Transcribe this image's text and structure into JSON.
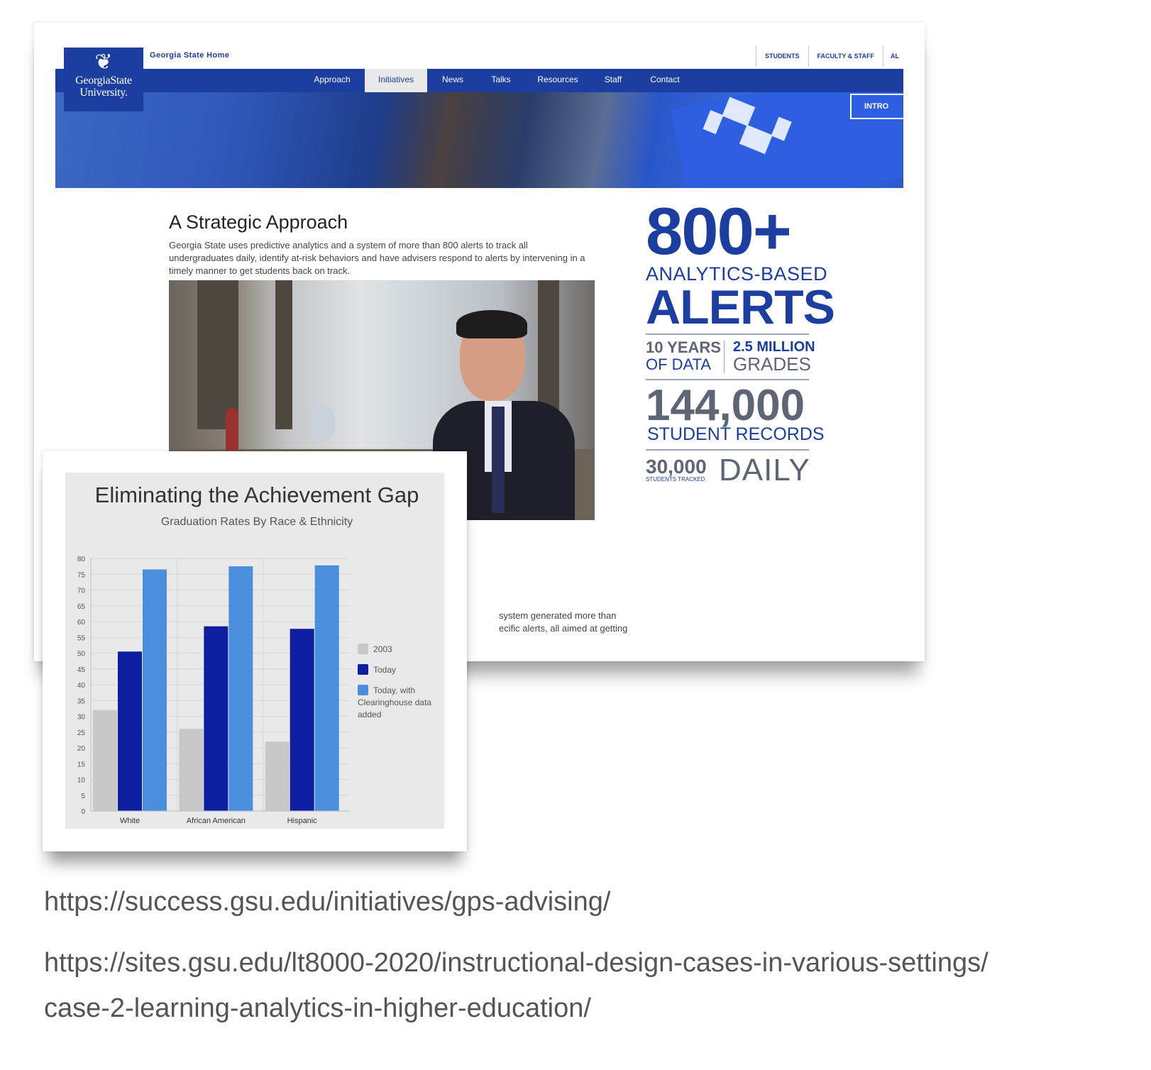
{
  "site": {
    "logo_line1": "GeorgiaState",
    "logo_line2": "University.",
    "home_link": "Georgia State Home",
    "audience_links": [
      "STUDENTS",
      "FACULTY & STAFF",
      "AL"
    ],
    "nav": [
      "Approach",
      "Initiatives",
      "News",
      "Talks",
      "Resources",
      "Staff",
      "Contact"
    ],
    "active_nav": "Initiatives",
    "hero_button": "INTRO"
  },
  "article": {
    "heading": "A Strategic Approach",
    "paragraph": "Georgia State uses predictive analytics and a system of more than 800 alerts to track all undergraduates daily, identify at-risk behaviors and have advisers respond to alerts by intervening in a timely manner to get students back on track.",
    "fragment_line1": "system generated more than",
    "fragment_line2": "ecific alerts, all aimed at getting"
  },
  "infographic": {
    "big_number": "800+",
    "analytics": "ANALYTICS-BASED",
    "alerts": "ALERTS",
    "years": "10 YEARS",
    "of_data": "OF DATA",
    "grades_count": "2.5 MILLION",
    "grades": "GRADES",
    "records_count": "144,000",
    "records": "STUDENT RECORDS",
    "tracked_count": "30,000",
    "tracked": "STUDENTS TRACKED",
    "daily": "DAILY"
  },
  "chart_data": {
    "type": "bar",
    "title": "Eliminating the Achievement Gap",
    "subtitle": "Graduation Rates By Race & Ethnicity",
    "categories": [
      "White",
      "African American",
      "Hispanic"
    ],
    "series": [
      {
        "name": "2003",
        "values": [
          32,
          26,
          22
        ],
        "color": "#c8c8c8"
      },
      {
        "name": "Today",
        "values": [
          50.5,
          58.5,
          57.7
        ],
        "color": "#0d1fa0"
      },
      {
        "name": "Today, with Clearinghouse data added",
        "values": [
          76.5,
          77.5,
          77.8
        ],
        "color": "#4a8fdd"
      }
    ],
    "yticks": [
      0,
      5,
      10,
      15,
      20,
      25,
      30,
      35,
      40,
      45,
      50,
      55,
      60,
      65,
      70,
      75,
      80
    ],
    "ylim": [
      0,
      80
    ],
    "grid": true,
    "legend_position": "right",
    "legend_lines": [
      [
        "2003"
      ],
      [
        "Today"
      ],
      [
        "Today, with",
        "Clearinghouse data",
        "added"
      ]
    ]
  },
  "captions": {
    "url1": "https://success.gsu.edu/initiatives/gps-advising/",
    "url2_line1": "https://sites.gsu.edu/lt8000-2020/instructional-design-cases-in-various-settings/",
    "url2_line2": "case-2-learning-analytics-in-higher-education/"
  }
}
